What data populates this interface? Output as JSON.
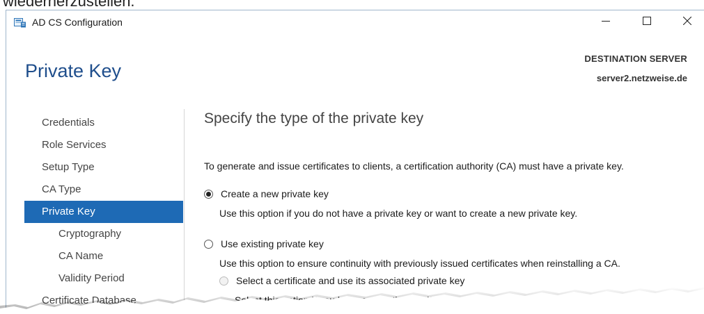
{
  "caption": "wiederherzustellen.",
  "window": {
    "title": "AD CS Configuration",
    "icons": {
      "app": "certificate-server-icon",
      "minimize": "minimize-icon",
      "maximize": "maximize-icon",
      "close": "close-icon"
    }
  },
  "header": {
    "page_title": "Private Key",
    "destination_label": "DESTINATION SERVER",
    "destination_server": "server2.netzweise.de"
  },
  "nav": {
    "items": [
      {
        "label": "Credentials",
        "level": 0,
        "active": false
      },
      {
        "label": "Role Services",
        "level": 0,
        "active": false
      },
      {
        "label": "Setup Type",
        "level": 0,
        "active": false
      },
      {
        "label": "CA Type",
        "level": 0,
        "active": false
      },
      {
        "label": "Private Key",
        "level": 0,
        "active": true
      },
      {
        "label": "Cryptography",
        "level": 1,
        "active": false
      },
      {
        "label": "CA Name",
        "level": 1,
        "active": false
      },
      {
        "label": "Validity Period",
        "level": 1,
        "active": false
      },
      {
        "label": "Certificate Database",
        "level": 0,
        "active": false
      }
    ]
  },
  "main": {
    "heading": "Specify the type of the private key",
    "intro": "To generate and issue certificates to clients, a certification authority (CA) must have a private key.",
    "options": [
      {
        "label": "Create a new private key",
        "selected": true,
        "description": "Use this option if you do not have a private key or want to create a new private key."
      },
      {
        "label": "Use existing private key",
        "selected": false,
        "description": "Use this option to ensure continuity with previously issued certificates when reinstalling a CA."
      }
    ],
    "sub_option": {
      "label": "Select a certificate and use its associated private key",
      "selected": false,
      "enabled": false,
      "description": "Select this option if you have an existing certificate on this computer or if you want to"
    }
  },
  "colors": {
    "accent": "#1e6ab5",
    "title": "#1f4e8c"
  }
}
